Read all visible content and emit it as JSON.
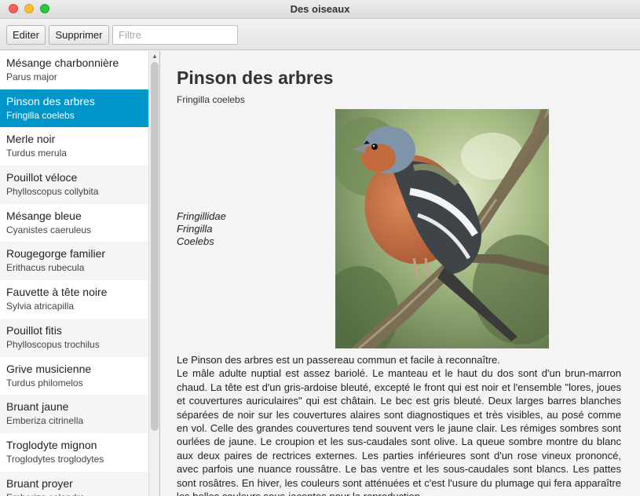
{
  "window": {
    "title": "Des oiseaux"
  },
  "toolbar": {
    "edit_label": "Editer",
    "delete_label": "Supprimer",
    "filter_placeholder": "Filtre",
    "filter_value": ""
  },
  "birds": [
    {
      "name": "Mésange charbonnière",
      "latin": "Parus major"
    },
    {
      "name": "Pinson des arbres",
      "latin": "Fringilla coelebs"
    },
    {
      "name": "Merle noir",
      "latin": "Turdus merula"
    },
    {
      "name": "Pouillot véloce",
      "latin": "Phylloscopus collybita"
    },
    {
      "name": "Mésange bleue",
      "latin": "Cyanistes caeruleus"
    },
    {
      "name": "Rougegorge familier",
      "latin": "Erithacus rubecula"
    },
    {
      "name": "Fauvette à tête noire",
      "latin": "Sylvia atricapilla"
    },
    {
      "name": "Pouillot fitis",
      "latin": "Phylloscopus trochilus"
    },
    {
      "name": "Grive musicienne",
      "latin": "Turdus philomelos"
    },
    {
      "name": "Bruant jaune",
      "latin": "Emberiza citrinella"
    },
    {
      "name": "Troglodyte mignon",
      "latin": "Troglodytes troglodytes"
    },
    {
      "name": "Bruant proyer",
      "latin": "Emberiza calandra"
    }
  ],
  "selected_index": 1,
  "detail": {
    "title": "Pinson des arbres",
    "latin": "Fringilla coelebs",
    "family": "Fringillidae",
    "genus": "Fringilla",
    "species": "Coelebs",
    "intro": "Le Pinson des arbres est un passereau commun et facile à reconnaître.",
    "description": "Le mâle adulte nuptial est assez bariolé. Le manteau et le haut du dos sont d'un brun-marron chaud. La tête est d'un gris-ardoise bleuté, excepté le front qui est noir et l'ensemble \"lores, joues et couvertures auriculaires\" qui est châtain. Le bec est gris bleuté. Deux larges barres blanches séparées de noir sur les couvertures alaires sont diagnostiques et très visibles, au posé comme en vol. Celle des grandes couvertures tend souvent vers le jaune clair. Les rémiges sombres sont ourlées de jaune. Le croupion et les sus-caudales sont olive. La queue sombre montre du blanc aux deux paires de rectrices externes. Les parties inférieures sont d'un rose vineux prononcé, avec parfois une nuance roussâtre. Le bas ventre et les sous-caudales sont blancs. Les pattes sont rosâtres. En hiver, les couleurs sont atténuées et c'est l'usure du plumage qui fera apparaître les belles couleurs sous-jacentes pour la reproduction."
  },
  "colors": {
    "selection": "#0096c9",
    "close": "#fe5f57",
    "minimize": "#febc2e",
    "maximize": "#28c840"
  }
}
